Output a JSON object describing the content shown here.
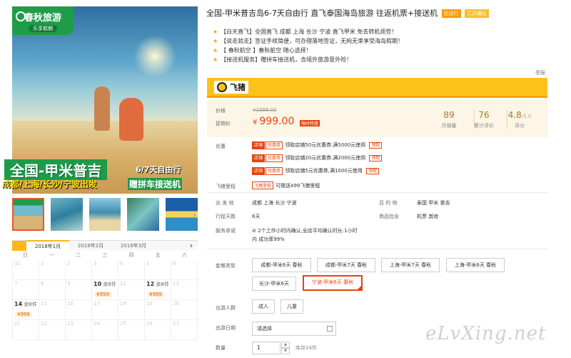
{
  "hero": {
    "logo_brand": "春秋旅游",
    "logo_sub": "乐享假期",
    "route": "全国-甲米普吉",
    "days": "6/7天自由行",
    "cities": "成都/上海/长沙/宁波出发",
    "gift": "赠拼车接送机"
  },
  "thumb_next": "›",
  "calendar": {
    "months": [
      "2018年1月",
      "2018年2月",
      "2018年3月"
    ],
    "next_icon": "›",
    "weekdays": [
      "日",
      "一",
      "二",
      "三",
      "四",
      "五",
      "六"
    ],
    "rows": [
      [
        {
          "d": "31"
        },
        {
          "d": "1"
        },
        {
          "d": "2"
        },
        {
          "d": "3"
        },
        {
          "d": "4"
        },
        {
          "d": "5"
        },
        {
          "d": "6"
        }
      ],
      [
        {
          "d": "7"
        },
        {
          "d": "8"
        },
        {
          "d": "9"
        },
        {
          "d": "10",
          "left": "余8件",
          "price": "¥999"
        },
        {
          "d": "11"
        },
        {
          "d": "12",
          "left": "余8件",
          "price": "¥999"
        },
        {
          "d": "13"
        }
      ],
      [
        {
          "d": "14",
          "left": "余8件",
          "price": "¥999"
        },
        {
          "d": "15"
        },
        {
          "d": "16"
        },
        {
          "d": "17"
        },
        {
          "d": "18"
        },
        {
          "d": "19"
        },
        {
          "d": "20"
        }
      ],
      [
        {
          "d": "21"
        },
        {
          "d": "22"
        },
        {
          "d": "23"
        },
        {
          "d": "24"
        },
        {
          "d": "25"
        },
        {
          "d": "26"
        },
        {
          "d": "27"
        }
      ]
    ]
  },
  "title": "全国-甲米普吉岛6-7天自由行 直飞泰国海岛旅游 往返机票+接送机",
  "tags": [
    "自由行",
    "二次确认"
  ],
  "features": [
    "【白天直飞】全国直飞 成都 上海 长沙 宁波 直飞甲米 免去转机烦劳！",
    "【说走就走】签证手续简便，可办理落地签证，无拘无束享受海岛假期！",
    "【 春秋航空 】春秋航空 随心选择！",
    "【接送机服务】赠拼车接送机，含境外旅游意外险！"
  ],
  "report": "举报",
  "feizhu": "飞猪",
  "price": {
    "label_price": "价格",
    "label_promo": "促销价",
    "original": "¥1998.00",
    "currency": "¥",
    "now": "999.00",
    "limit_tag": "限时特惠",
    "sales": {
      "value": "89",
      "label": "月销量"
    },
    "reviews": {
      "value": "76",
      "label": "累计评价"
    },
    "score": {
      "value": "4.8",
      "total": "/5.0",
      "label": "评分"
    }
  },
  "coupons": {
    "label": "优惠",
    "dian": "店铺",
    "quan": "优惠券",
    "get": "领取",
    "items": [
      "领取店铺50元优惠券,满5000元使用",
      "领取店铺20元优惠券,满2000元使用",
      "领取店铺5元优惠券,满1000元使用"
    ]
  },
  "mileage": {
    "label": "飞猪里程",
    "tag": "飞猪里程",
    "text": "可赠送499飞猪里程"
  },
  "info": {
    "depart_label": "出 发 地",
    "depart_value": "成都  上海  长沙  宁波",
    "dest_label": "目 的 地",
    "dest_value": "泰国  甲米  普吉",
    "days_label": "行程天数",
    "days_value": "6天",
    "include_label": "商品包含",
    "include_value": "机票  其他",
    "service_label": "服务承诺",
    "service_line1": "2个工作小时内确认,全店平均确认时长:1小时",
    "service_line2": "内 成功率99%"
  },
  "package": {
    "label": "套餐类型",
    "options": [
      "成都-甲米6天 春秋",
      "成都-甲米7天 春秋",
      "上海-甲米7天 春秋",
      "上海-甲米6天 春秋",
      "长沙-甲米6天",
      "宁波-甲米6天 春秋"
    ]
  },
  "people": {
    "label": "出游人群",
    "options": [
      "成人",
      "儿童"
    ]
  },
  "date": {
    "label": "出游日期",
    "placeholder": "请选择"
  },
  "quantity": {
    "label": "数量",
    "value": "1",
    "up": "▲",
    "down": "▼",
    "stock": "库存24件"
  },
  "watermark": "eLvXing.net"
}
